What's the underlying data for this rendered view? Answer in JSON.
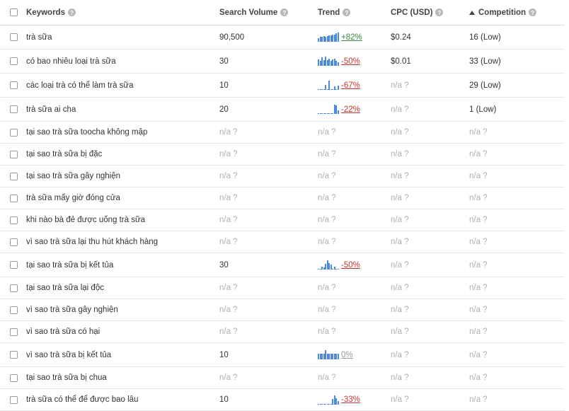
{
  "headers": {
    "keywords": "Keywords",
    "search_volume": "Search Volume",
    "trend": "Trend",
    "cpc": "CPC (USD)",
    "competition": "Competition",
    "help": "?"
  },
  "colors": {
    "spark": "#4a89dc",
    "positive": "#3a8a3a",
    "negative": "#c0392b",
    "muted": "#b0b0b0"
  },
  "rows": [
    {
      "keyword": "trà sữa",
      "volume": "90,500",
      "trend": "+82%",
      "trend_dir": "pos",
      "spark": [
        0.4,
        0.5,
        0.5,
        0.6,
        0.55,
        0.6,
        0.7,
        0.7,
        0.75,
        0.8,
        0.9,
        1.0
      ],
      "cpc": "$0.24",
      "competition": "16 (Low)"
    },
    {
      "keyword": "có bao nhiêu loại trà sữa",
      "volume": "30",
      "trend": "-50%",
      "trend_dir": "neg",
      "spark": [
        0.7,
        0.5,
        0.9,
        0.6,
        1.0,
        0.6,
        0.8,
        0.5,
        0.7,
        0.8,
        0.5,
        0.4
      ],
      "cpc": "$0.01",
      "competition": "33 (Low)"
    },
    {
      "keyword": "các loại trà có thể làm trà sữa",
      "volume": "10",
      "trend": "-67%",
      "trend_dir": "neg",
      "spark": [
        0.05,
        0.05,
        0.05,
        0.05,
        0.5,
        0.05,
        1.0,
        0.05,
        0.05,
        0.4,
        0.05,
        0.45
      ],
      "cpc": "n/a ?",
      "competition": "29 (Low)"
    },
    {
      "keyword": "trà sữa ai cha",
      "volume": "20",
      "trend": "-22%",
      "trend_dir": "neg",
      "spark": [
        0.05,
        0.05,
        0.05,
        0.05,
        0.05,
        0.05,
        0.05,
        0.05,
        0.05,
        1.0,
        0.9,
        0.4
      ],
      "cpc": "n/a ?",
      "competition": "1 (Low)"
    },
    {
      "keyword": "tại sao trà sữa toocha không mập",
      "volume": "n/a ?",
      "trend": "n/a ?",
      "trend_dir": "na",
      "spark": [],
      "cpc": "n/a ?",
      "competition": "n/a ?"
    },
    {
      "keyword": "tại sao trà sữa bị đặc",
      "volume": "n/a ?",
      "trend": "n/a ?",
      "trend_dir": "na",
      "spark": [],
      "cpc": "n/a ?",
      "competition": "n/a ?"
    },
    {
      "keyword": "tại sao trà sữa gây nghiện",
      "volume": "n/a ?",
      "trend": "n/a ?",
      "trend_dir": "na",
      "spark": [],
      "cpc": "n/a ?",
      "competition": "n/a ?"
    },
    {
      "keyword": "trà sữa mấy giờ đóng cửa",
      "volume": "n/a ?",
      "trend": "n/a ?",
      "trend_dir": "na",
      "spark": [],
      "cpc": "n/a ?",
      "competition": "n/a ?"
    },
    {
      "keyword": "khi nào bà đẻ được uống trà sữa",
      "volume": "n/a ?",
      "trend": "n/a ?",
      "trend_dir": "na",
      "spark": [],
      "cpc": "n/a ?",
      "competition": "n/a ?"
    },
    {
      "keyword": "vì sao trà sữa lại thu hút khách hàng",
      "volume": "n/a ?",
      "trend": "n/a ?",
      "trend_dir": "na",
      "spark": [],
      "cpc": "n/a ?",
      "competition": "n/a ?"
    },
    {
      "keyword": "tại sao trà sữa bị kết tủa",
      "volume": "30",
      "trend": "-50%",
      "trend_dir": "neg",
      "spark": [
        0.05,
        0.05,
        0.3,
        0.2,
        0.6,
        1.0,
        0.7,
        0.5,
        0.05,
        0.3,
        0.05,
        0.05
      ],
      "cpc": "n/a ?",
      "competition": "n/a ?"
    },
    {
      "keyword": "tại sao trà sữa lại độc",
      "volume": "n/a ?",
      "trend": "n/a ?",
      "trend_dir": "na",
      "spark": [],
      "cpc": "n/a ?",
      "competition": "n/a ?"
    },
    {
      "keyword": "vì sao trà sữa gây nghiện",
      "volume": "n/a ?",
      "trend": "n/a ?",
      "trend_dir": "na",
      "spark": [],
      "cpc": "n/a ?",
      "competition": "n/a ?"
    },
    {
      "keyword": "vì sao trà sữa có hại",
      "volume": "n/a ?",
      "trend": "n/a ?",
      "trend_dir": "na",
      "spark": [],
      "cpc": "n/a ?",
      "competition": "n/a ?"
    },
    {
      "keyword": "vì sao trà sữa bị kết tủa",
      "volume": "10",
      "trend": "0%",
      "trend_dir": "zero",
      "spark": [
        0.6,
        0.6,
        0.6,
        0.6,
        1.0,
        0.6,
        0.6,
        0.6,
        0.6,
        0.6,
        0.6,
        0.6
      ],
      "cpc": "n/a ?",
      "competition": "n/a ?"
    },
    {
      "keyword": "tại sao trà sữa bị chua",
      "volume": "n/a ?",
      "trend": "n/a ?",
      "trend_dir": "na",
      "spark": [],
      "cpc": "n/a ?",
      "competition": "n/a ?"
    },
    {
      "keyword": "trà sữa có thể để được bao lâu",
      "volume": "10",
      "trend": "-33%",
      "trend_dir": "neg",
      "spark": [
        0.05,
        0.05,
        0.05,
        0.05,
        0.05,
        0.05,
        0.05,
        0.05,
        0.6,
        1.0,
        0.7,
        0.4
      ],
      "cpc": "n/a ?",
      "competition": "n/a ?"
    }
  ]
}
